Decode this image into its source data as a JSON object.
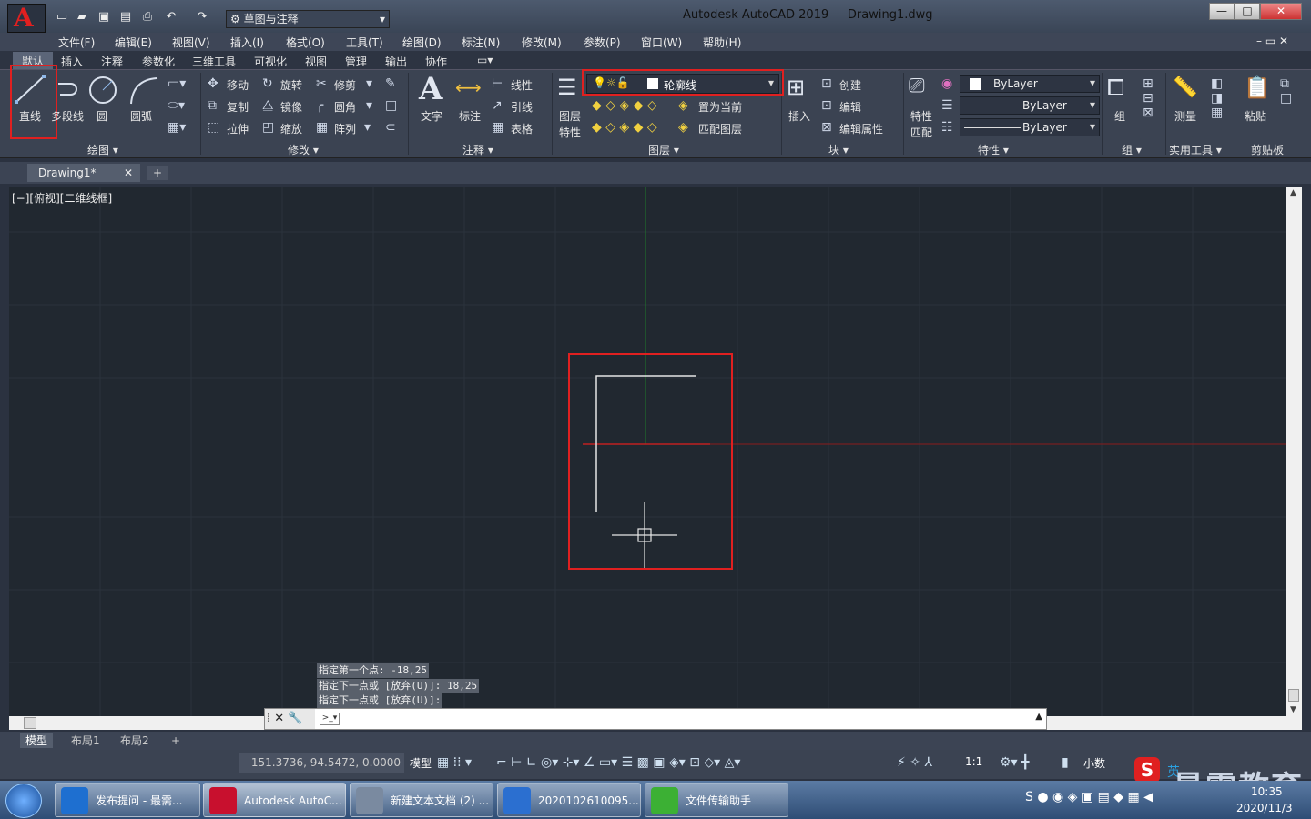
{
  "window": {
    "app_title": "Autodesk AutoCAD 2019",
    "file_name": "Drawing1.dwg",
    "app_button": "A",
    "min": "—",
    "max": "□",
    "close": "✕"
  },
  "qat": {
    "workspace": "草图与注释"
  },
  "menu": [
    "文件(F)",
    "编辑(E)",
    "视图(V)",
    "插入(I)",
    "格式(O)",
    "工具(T)",
    "绘图(D)",
    "标注(N)",
    "修改(M)",
    "参数(P)",
    "窗口(W)",
    "帮助(H)"
  ],
  "ribbon_tabs": [
    "默认",
    "插入",
    "注释",
    "参数化",
    "三维工具",
    "可视化",
    "视图",
    "管理",
    "输出",
    "协作"
  ],
  "draw": {
    "line": "直线",
    "polyline": "多段线",
    "circle": "圆",
    "arc": "圆弧",
    "panel": "绘图 ▾"
  },
  "modify": {
    "move": "移动",
    "rotate": "旋转",
    "trim": "修剪",
    "copy": "复制",
    "mirror": "镜像",
    "fillet": "圆角",
    "stretch": "拉伸",
    "scale": "缩放",
    "array": "阵列",
    "panel": "修改 ▾"
  },
  "annotation": {
    "text": "文字",
    "dimension": "标注",
    "linear": "线性",
    "leader": "引线",
    "table": "表格",
    "panel": "注释 ▾"
  },
  "layers": {
    "layer_props_1": "图层",
    "layer_props_2": "特性",
    "current_layer": "轮廓线",
    "set_current": "置为当前",
    "match": "匹配图层",
    "panel": "图层 ▾"
  },
  "block": {
    "insert": "插入",
    "create": "创建",
    "edit": "编辑",
    "edit_attr": "编辑属性",
    "panel": "块 ▾"
  },
  "properties": {
    "match_1": "特性",
    "match_2": "匹配",
    "color": "ByLayer",
    "linetype": "ByLayer",
    "lineweight": "ByLayer",
    "panel": "特性 ▾"
  },
  "groups": {
    "group": "组",
    "panel": "组 ▾"
  },
  "utilities": {
    "measure": "测量",
    "panel": "实用工具 ▾"
  },
  "clipboard": {
    "paste": "粘贴",
    "panel": "剪贴板"
  },
  "doc_tab": "Drawing1*",
  "viewport_label": "[−][俯视][二维线框]",
  "command_history": [
    "指定第一个点: -18,25",
    "指定下一点或 [放弃(U)]: 18,25",
    "指定下一点或 [放弃(U)]:"
  ],
  "layout_tabs": [
    "模型",
    "布局1",
    "布局2"
  ],
  "status": {
    "coords": "-151.3736, 94.5472, 0.0000",
    "model": "模型",
    "scale": "1:1",
    "units": "小数"
  },
  "taskbar": [
    {
      "label": "发布提问 - 最需...",
      "color": "#1e6fd0"
    },
    {
      "label": "Autodesk AutoC...",
      "color": "#c8102e"
    },
    {
      "label": "新建文本文档 (2) ...",
      "color": "#7a8aa0"
    },
    {
      "label": "2020102610095...",
      "color": "#2b6fd0"
    },
    {
      "label": "文件传输助手",
      "color": "#3cb034"
    }
  ],
  "clock": {
    "time": "10:35",
    "date": "2020/11/3"
  },
  "watermark": "最需教育",
  "ime": "英",
  "colors": {
    "highlight": "#e02020",
    "canvas": "#212830",
    "x_axis": "#c02020",
    "y_axis": "#1f7a2a"
  }
}
